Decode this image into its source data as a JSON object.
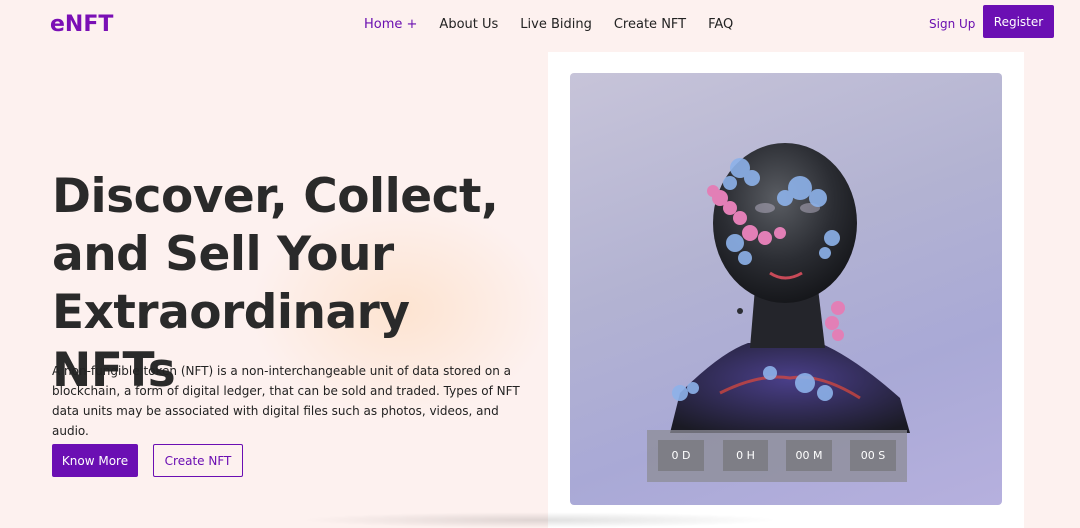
{
  "brand": {
    "logo": "eNFT",
    "accent_color": "#6b0fb3"
  },
  "nav": {
    "items": [
      {
        "label": "Home +",
        "active": true
      },
      {
        "label": "About Us",
        "active": false
      },
      {
        "label": "Live Biding",
        "active": false
      },
      {
        "label": "Create NFT",
        "active": false
      },
      {
        "label": "FAQ",
        "active": false
      }
    ],
    "signup_label": "Sign Up",
    "register_label": "Register"
  },
  "hero": {
    "title": "Discover, Collect, and Sell Your Extraordinary NFTs",
    "description": "A non-fungible token (NFT) is a non-interchangeable unit of data stored on a blockchain, a form of digital ledger, that can be sold and traded. Types of NFT data units may be associated with digital files such as photos, videos, and audio.",
    "primary_button": "Know More",
    "secondary_button": "Create NFT"
  },
  "featured": {
    "image_icon": "sculpture-head-artwork",
    "countdown": {
      "days": "0 D",
      "hours": "0 H",
      "minutes": "00 M",
      "seconds": "00 S"
    }
  }
}
